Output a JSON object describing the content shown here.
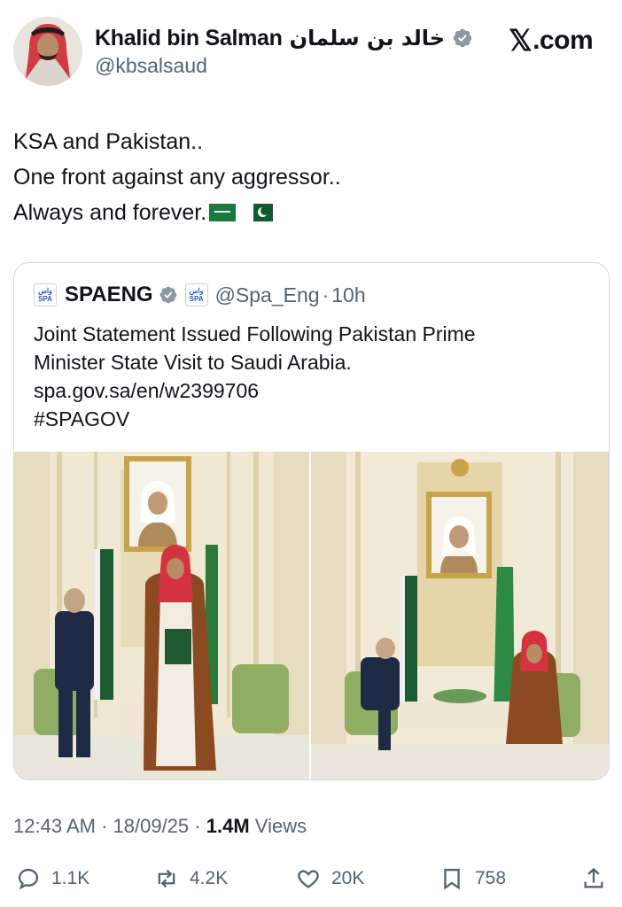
{
  "author": {
    "name": "Khalid bin Salman",
    "name_arabic": "خالد بن سلمان",
    "handle": "@kbsalsaud"
  },
  "brand": {
    "x_logo": "𝕏",
    "domain": ".com"
  },
  "tweet": {
    "lines": [
      "KSA and Pakistan..",
      "One front against any aggressor..",
      "Always and forever."
    ],
    "flags": [
      "saudi-arabia-flag",
      "pakistan-flag"
    ]
  },
  "quote": {
    "logo_text_top": "واس",
    "logo_text_bottom": "SPA",
    "name": "SPAENG",
    "handle": "@Spa_Eng",
    "separator": "·",
    "time": "10h",
    "lines": [
      "Joint Statement Issued Following Pakistan Prime",
      "Minister State Visit to Saudi Arabia.",
      "spa.gov.sa/en/w2399706",
      "#SPAGOV"
    ],
    "photos": [
      "handshake-photo",
      "seated-meeting-photo"
    ]
  },
  "meta": {
    "time": "12:43 AM",
    "dot": "·",
    "date": "18/09/25",
    "views_count": "1.4M",
    "views_label": "Views"
  },
  "actions": {
    "replies": "1.1K",
    "reposts": "4.2K",
    "likes": "20K",
    "bookmarks": "758"
  },
  "colors": {
    "verified": "#8b98a5",
    "text": "#0f1419",
    "secondary": "#536471",
    "border": "#cfd9de"
  }
}
